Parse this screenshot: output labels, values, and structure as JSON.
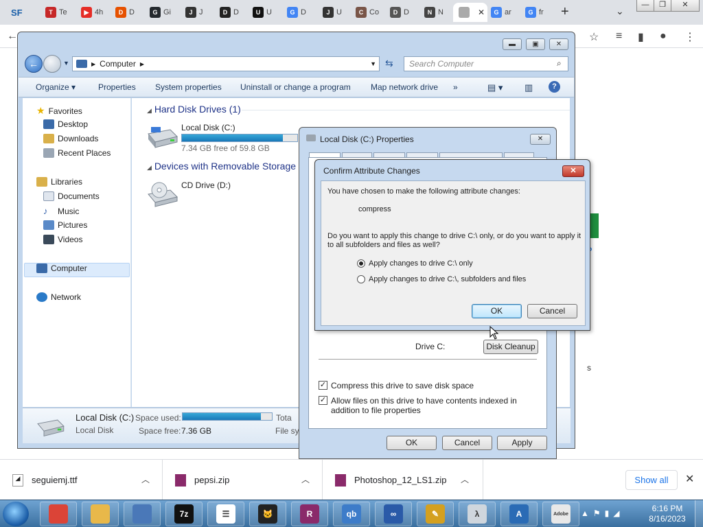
{
  "browser": {
    "tabs": [
      {
        "label": "Te",
        "fav": "T",
        "color": "#c62828"
      },
      {
        "label": "4h",
        "fav": "▶",
        "color": "#e52d27"
      },
      {
        "label": "D",
        "fav": "D",
        "color": "#e65100"
      },
      {
        "label": "Gi",
        "fav": "G",
        "color": "#24292e"
      },
      {
        "label": "J",
        "fav": "J",
        "color": "#333333"
      },
      {
        "label": "D",
        "fav": "D",
        "color": "#222222"
      },
      {
        "label": "U",
        "fav": "U",
        "color": "#111111"
      },
      {
        "label": "D",
        "fav": "G",
        "color": "#4285f4"
      },
      {
        "label": "U",
        "fav": "J",
        "color": "#333333"
      },
      {
        "label": "Co",
        "fav": "C",
        "color": "#795548"
      },
      {
        "label": "D",
        "fav": "D",
        "color": "#555555"
      },
      {
        "label": "N",
        "fav": "N",
        "color": "#444444"
      },
      {
        "label": "",
        "fav": "",
        "color": "#aaaaaa"
      },
      {
        "label": "ar",
        "fav": "G",
        "color": "#4285f4"
      },
      {
        "label": "fr",
        "fav": "G",
        "color": "#4285f4"
      }
    ],
    "first_tab_icon": "SF",
    "new_tab": "+",
    "page_green_button_color": "#1e8e3e",
    "page_partial_link": "d?",
    "page_partial_text": "s"
  },
  "downloads": {
    "items": [
      {
        "name": "seguiemj.ttf",
        "icon": "font-file-icon"
      },
      {
        "name": "pepsi.zip",
        "icon": "winrar-archive-icon"
      },
      {
        "name": "Photoshop_12_LS1.zip",
        "icon": "winrar-archive-icon"
      }
    ],
    "show_all": "Show all"
  },
  "explorer": {
    "address": "Computer",
    "search_placeholder": "Search Computer",
    "commands": [
      "Organize",
      "Properties",
      "System properties",
      "Uninstall or change a program",
      "Map network drive",
      "»"
    ],
    "nav": {
      "favorites": "Favorites",
      "desktop": "Desktop",
      "downloads": "Downloads",
      "recent": "Recent Places",
      "libraries": "Libraries",
      "documents": "Documents",
      "music": "Music",
      "pictures": "Pictures",
      "videos": "Videos",
      "computer": "Computer",
      "network": "Network"
    },
    "groups": {
      "hdd": "Hard Disk Drives (1)",
      "removable": "Devices with Removable Storage"
    },
    "drives": {
      "c_name": "Local Disk (C:)",
      "c_free": "7.34 GB free of 59.8 GB",
      "c_used_fraction": 0.877,
      "d_name": "CD Drive (D:)"
    },
    "details": {
      "name": "Local Disk (C:)",
      "type": "Local Disk",
      "space_used_label": "Space used:",
      "space_free_label": "Space free:",
      "space_free": "7.36 GB",
      "total_label": "Tota",
      "filesys_label": "File sys"
    }
  },
  "props": {
    "title": "Local Disk (C:) Properties",
    "drive_label": "Drive C:",
    "disk_cleanup": "Disk Cleanup",
    "compress_label": "Compress this drive to save disk space",
    "index_label": "Allow files on this drive to have contents indexed in addition to file properties",
    "ok": "OK",
    "cancel": "Cancel",
    "apply": "Apply"
  },
  "confirm": {
    "title": "Confirm Attribute Changes",
    "intro": "You have chosen to make the following attribute changes:",
    "change": "compress",
    "question": "Do you want to apply this change to drive C:\\ only, or do you want to apply it to all subfolders and files as well?",
    "option1": "Apply changes to drive C:\\ only",
    "option2": "Apply changes to drive C:\\, subfolders and files",
    "ok": "OK",
    "cancel": "Cancel"
  },
  "taskbar": {
    "apps": [
      {
        "icon": "chrome-icon",
        "color": "#db4437",
        "text": ""
      },
      {
        "icon": "explorer-folder-icon",
        "color": "#e8b84a",
        "text": ""
      },
      {
        "icon": "computer-network-icon",
        "color": "#4a78b8",
        "text": ""
      },
      {
        "icon": "7zip-icon",
        "color": "#111111",
        "text": "7z"
      },
      {
        "icon": "list-app-icon",
        "color": "#ffffff",
        "text": "☰"
      },
      {
        "icon": "cat-app-icon",
        "color": "#222222",
        "text": "🐱"
      },
      {
        "icon": "winrar-icon",
        "color": "#8a2a6a",
        "text": "R"
      },
      {
        "icon": "qbittorrent-icon",
        "color": "#3d7cc9",
        "text": "qb"
      },
      {
        "icon": "infinity-app-icon",
        "color": "#2a5aa8",
        "text": "∞"
      },
      {
        "icon": "tools-app-icon",
        "color": "#d4a020",
        "text": "✎"
      },
      {
        "icon": "lambda-app-icon",
        "color": "#cfd6dd",
        "text": "λ"
      },
      {
        "icon": "a-app-icon",
        "color": "#2a6bb5",
        "text": "A"
      },
      {
        "icon": "adobe-app-icon",
        "color": "#e8e8e8",
        "text": "Adobe"
      }
    ],
    "time": "6:16 PM",
    "date": "8/16/2023"
  }
}
